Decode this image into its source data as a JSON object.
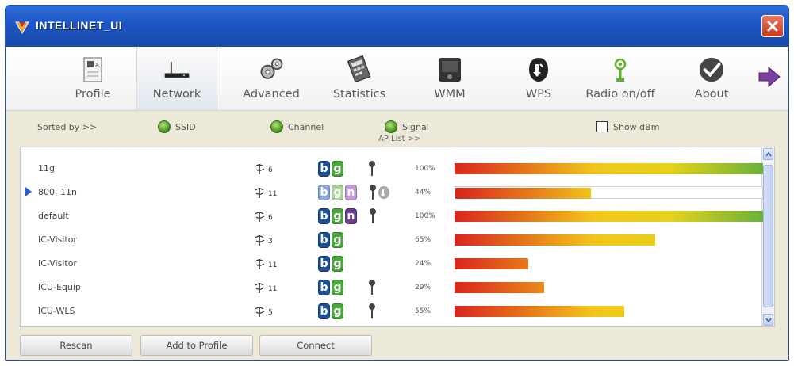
{
  "window": {
    "title": "INTELLINET_UI",
    "close_label": "close"
  },
  "toolbar": {
    "items": [
      {
        "label": "Profile",
        "icon": "profile-icon"
      },
      {
        "label": "Network",
        "icon": "router-icon",
        "active": true
      },
      {
        "label": "Advanced",
        "icon": "gears-icon"
      },
      {
        "label": "Statistics",
        "icon": "statistics-icon"
      },
      {
        "label": "WMM",
        "icon": "wmm-icon"
      },
      {
        "label": "WPS",
        "icon": "wps-icon"
      },
      {
        "label": "Radio on/off",
        "icon": "radio-icon"
      },
      {
        "label": "About",
        "icon": "about-check-icon"
      }
    ],
    "next_icon": "next-arrow-icon"
  },
  "sortbar": {
    "sorted_by_label": "Sorted by >>",
    "options": [
      {
        "label": "SSID"
      },
      {
        "label": "Channel"
      },
      {
        "label": "Signal"
      }
    ],
    "ap_list_label": "AP List >>",
    "show_dbm_label": "Show dBm",
    "show_dbm_checked": false
  },
  "networks": [
    {
      "ssid": "11g",
      "channel": "6",
      "modes": [
        "b",
        "g"
      ],
      "key": true,
      "wps": false,
      "signal_label": "100%",
      "signal": 100,
      "selected": false
    },
    {
      "ssid": "800, 11n",
      "channel": "11",
      "modes": [
        "b",
        "g",
        "n"
      ],
      "key": true,
      "wps": true,
      "signal_label": "44%",
      "signal": 44,
      "selected": true
    },
    {
      "ssid": "default",
      "channel": "6",
      "modes": [
        "b",
        "g",
        "n"
      ],
      "key": true,
      "wps": false,
      "signal_label": "100%",
      "signal": 100,
      "selected": false
    },
    {
      "ssid": "IC-Visitor",
      "channel": "3",
      "modes": [
        "b",
        "g"
      ],
      "key": false,
      "wps": false,
      "signal_label": "65%",
      "signal": 65,
      "selected": false
    },
    {
      "ssid": "IC-Visitor",
      "channel": "11",
      "modes": [
        "b",
        "g"
      ],
      "key": false,
      "wps": false,
      "signal_label": "24%",
      "signal": 24,
      "selected": false
    },
    {
      "ssid": "ICU-Equip",
      "channel": "11",
      "modes": [
        "b",
        "g"
      ],
      "key": true,
      "wps": false,
      "signal_label": "29%",
      "signal": 29,
      "selected": false
    },
    {
      "ssid": "ICU-WLS",
      "channel": "5",
      "modes": [
        "b",
        "g"
      ],
      "key": true,
      "wps": false,
      "signal_label": "55%",
      "signal": 55,
      "selected": false
    }
  ],
  "buttons": {
    "rescan": "Rescan",
    "add_to_profile": "Add to Profile",
    "connect": "Connect"
  },
  "colors": {
    "title_bar": "#1f57c7",
    "signal_low": "#d9241c",
    "signal_high": "#6ab23a",
    "mode_b": "#1e4e93",
    "mode_g": "#49a83a",
    "mode_n": "#6e3c8e"
  }
}
